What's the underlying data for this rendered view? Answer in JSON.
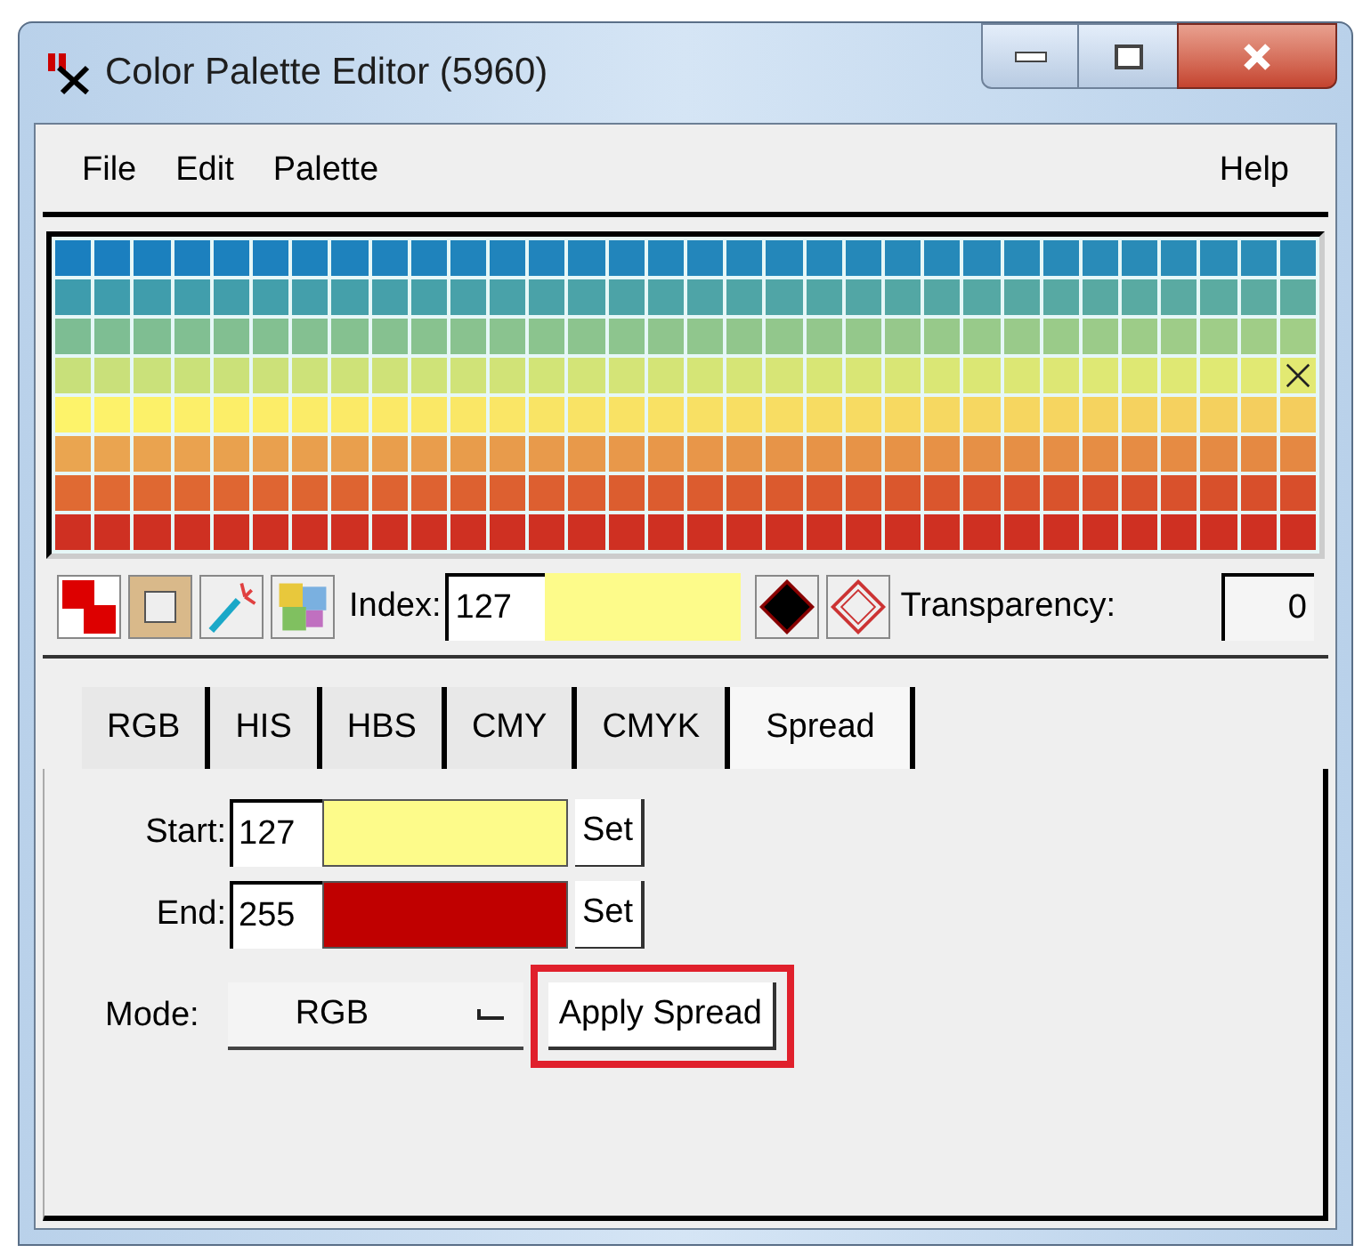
{
  "window": {
    "title": "Color Palette Editor (5960)"
  },
  "menu": {
    "left": [
      "File",
      "Edit",
      "Palette"
    ],
    "right": [
      "Help"
    ]
  },
  "palette": {
    "rows": [
      {
        "color": "#1a7fbf",
        "marked": false
      },
      {
        "color": "#3e9cad",
        "marked": false
      },
      {
        "color": "#7dbd93",
        "marked": false
      },
      {
        "color": "#c8e07a",
        "marked": true
      },
      {
        "color": "#fdf36a",
        "marked": false
      },
      {
        "color": "#eaa550",
        "marked": false
      },
      {
        "color": "#e06a33",
        "marked": false
      },
      {
        "color": "#cf3022",
        "marked": false
      }
    ]
  },
  "toolbar": {
    "index": {
      "label": "Index:",
      "value": "127",
      "color": "#fdfb8a"
    },
    "transparency_label": "Transparency:",
    "transparency_value": "0"
  },
  "tabs": [
    {
      "label": "RGB",
      "selected": false
    },
    {
      "label": "HIS",
      "selected": false
    },
    {
      "label": "HBS",
      "selected": false
    },
    {
      "label": "CMY",
      "selected": false
    },
    {
      "label": "CMYK",
      "selected": false
    },
    {
      "label": "Spread",
      "selected": true
    }
  ],
  "spread": {
    "rows": [
      {
        "label": "Start:",
        "value": "127",
        "color": "#fdfb8a",
        "button": "Set"
      },
      {
        "label": "End:",
        "value": "255",
        "color": "#c00000",
        "button": "Set"
      }
    ],
    "mode_label": "Mode:",
    "mode_value": "RGB",
    "apply_button": "Apply Spread",
    "apply_highlighted": true
  }
}
